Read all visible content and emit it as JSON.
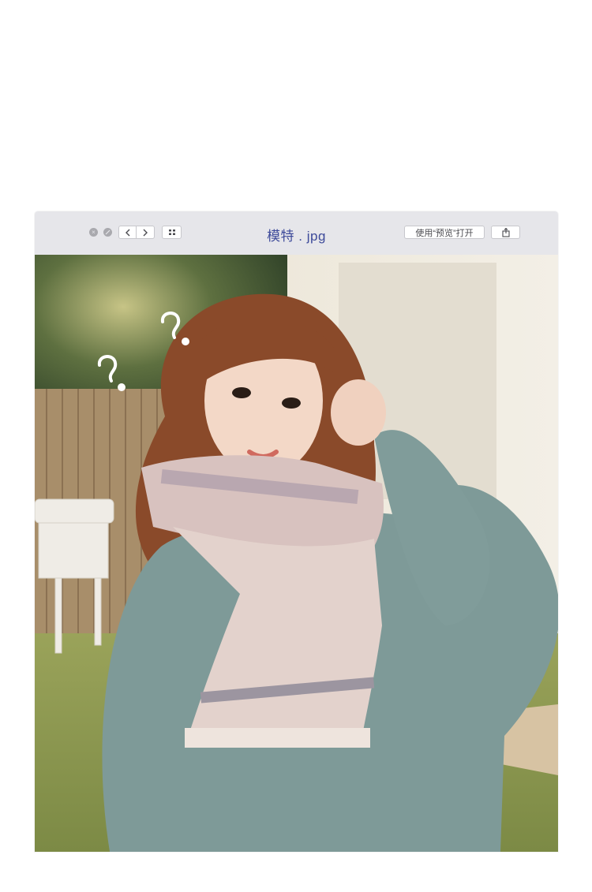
{
  "window": {
    "title": "模特 . jpg",
    "open_with_preview_label": "使用“预览”打开"
  },
  "icons": {
    "close": "close-icon",
    "minimize": "minimize-icon",
    "back": "chevron-left-icon",
    "forward": "chevron-right-icon",
    "grid": "grid-view-icon",
    "share": "share-icon"
  },
  "photo": {
    "annotation_marks": [
      "?",
      "?"
    ]
  },
  "colors": {
    "titlebar": "#e6e6ea",
    "title_text": "#3d4a9a",
    "sweater": "#7e9a98",
    "scarf": "#d8c2bf"
  }
}
